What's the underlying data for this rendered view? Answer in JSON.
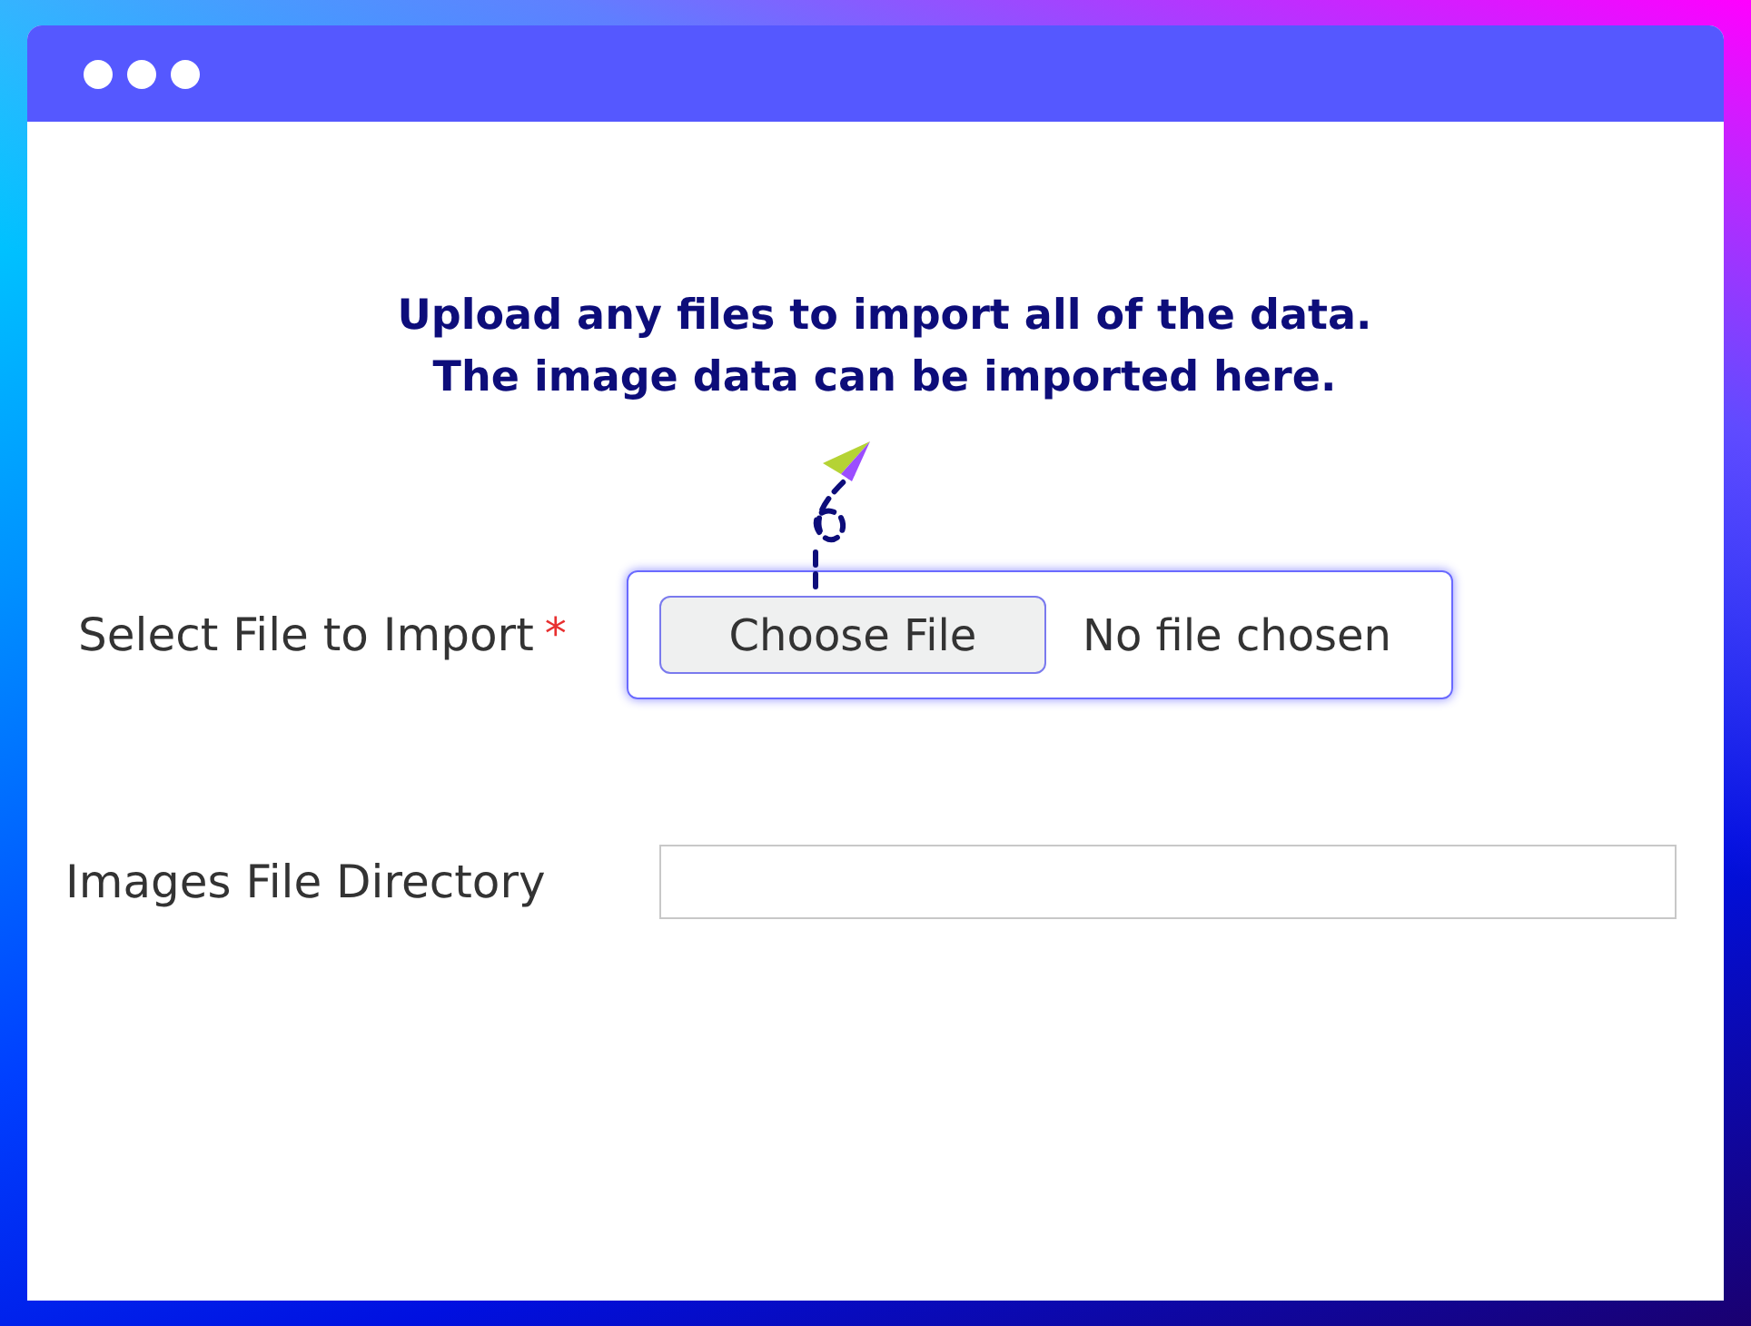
{
  "hint": [
    "Upload any files to import all of the data.",
    "The image data can be imported here."
  ],
  "fields": [
    {
      "kind": "file",
      "label": "Select File to Import",
      "required_mark": "*",
      "button": "Choose File",
      "status": "No file chosen"
    },
    {
      "kind": "text",
      "label": "Images File Directory"
    }
  ]
}
